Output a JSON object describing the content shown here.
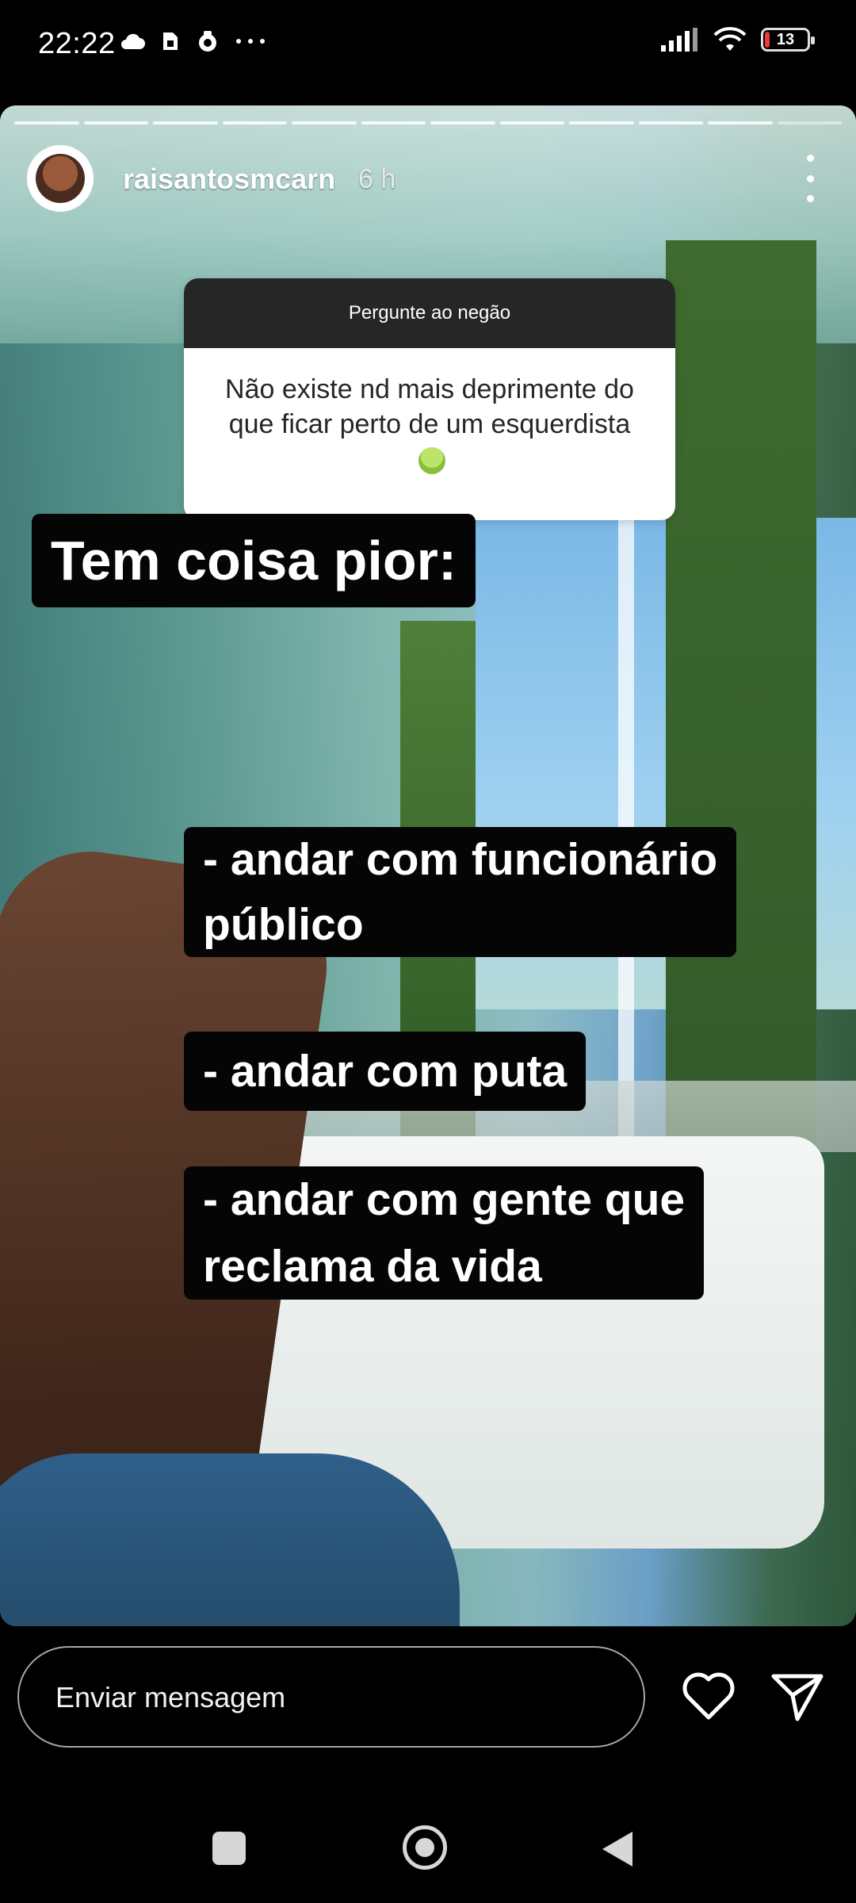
{
  "status_bar": {
    "time": "22:22",
    "battery_level": "13",
    "left_icons": [
      "cloud-icon",
      "sim-icon",
      "app-notification-icon",
      "more-notifications-icon"
    ],
    "right_icons": [
      "signal-icon",
      "wifi-icon",
      "battery-icon"
    ]
  },
  "story": {
    "username": "raisantosmcarn",
    "time_ago": "6 h",
    "progress_segments": 12,
    "question_box": {
      "header": "Pergunte ao negão",
      "text": "Não existe nd mais deprimente do que ficar perto de um esquerdista"
    },
    "captions": {
      "title": "Tem coisa pior:",
      "item1_line1": "- andar com funcionário",
      "item1_line2": "público",
      "item2": "- andar com puta",
      "item3_line1": "- andar com gente que",
      "item3_line2": "reclama da vida"
    }
  },
  "reply_bar": {
    "placeholder": "Enviar mensagem"
  },
  "actions": {
    "like_icon": "heart-icon",
    "send_icon": "send-icon"
  },
  "nav_bar": {
    "buttons": [
      "recents-button",
      "home-button",
      "back-button"
    ]
  }
}
